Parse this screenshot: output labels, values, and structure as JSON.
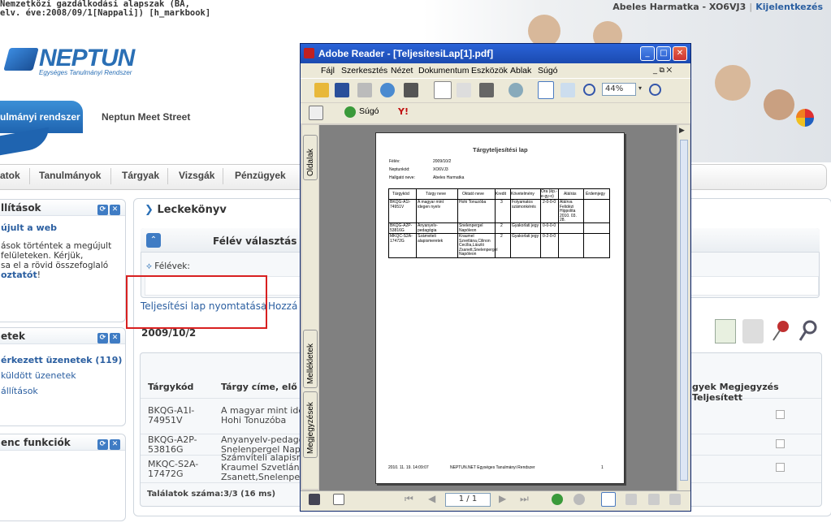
{
  "header": {
    "info_line1": "Nemzetközi gazdálkodási alapszak (BA,",
    "info_line2": "elv. éve:2008/09/1[Nappali]) [h_markbook]",
    "user": "Abeles Harmatka - XO6VJ3",
    "logout": "Kijelentkezés",
    "logo_name": "NEPTUN",
    "logo_sub": "Egységes Tanulmányi Rendszer",
    "tab_main": "ulmányi rendszer",
    "tab_meet": "Neptun Meet Street"
  },
  "menu": [
    "atok",
    "Tanulmányok",
    "Tárgyak",
    "Vizsgák",
    "Pénzügyek"
  ],
  "sidebar": {
    "box1": {
      "title": "llítások",
      "link": "újult a web",
      "text1": "ások történtek a megújult",
      "text2": "felületeken. Kérjük,",
      "text3": "sa el a rövid összefoglaló",
      "link2": "oztatót",
      "tail": "!"
    },
    "box2": {
      "title": "etek",
      "items": [
        "érkezett üzenetek (119)",
        "küldött üzenetek",
        "állítások"
      ]
    },
    "box3": {
      "title": "enc funkciók"
    }
  },
  "main": {
    "title": "Leckekönyv",
    "semester_panel_title": "Félév választás",
    "semesters_label": "Félévek:",
    "print_link": "Teljesítési lap nyomtatása",
    "add_link": "Hozzá",
    "semester": "2009/10/2",
    "columns": {
      "code": "Tárgykód",
      "name": "Tárgy címe, elő",
      "tail": "gyek Megjegyzés Teljesített"
    },
    "rows": [
      {
        "code1": "BKQG-A1I-",
        "code2": "74951V",
        "name1": "A magyar mint ideg",
        "name2": "Hohi Tonuzóba"
      },
      {
        "code1": "BKQG-A2P-",
        "code2": "53816G",
        "name1": "Anyanyelv-pedagóg",
        "name2": "Snelenpergel Napól"
      },
      {
        "code1": "MKQC-S2A-",
        "code2": "17472G",
        "name1": "Számviteli alapism",
        "name2": "Kraumel Szvetlána,",
        "name3": "Zsanett,Snelenperg"
      }
    ],
    "found": "Találatok száma:3/3 (16 ms)"
  },
  "adobe": {
    "title": "Adobe Reader - [TeljesitesiLap[1].pdf]",
    "menu": [
      "Fájl",
      "Szerkesztés",
      "Nézet",
      "Dokumentum",
      "Eszközök",
      "Ablak",
      "Súgó"
    ],
    "zoom": "44%",
    "help": "Súgó",
    "side_tabs": [
      "Oldalak",
      "Mellékletek",
      "Megjegyzések"
    ],
    "page_indicator": "1 / 1",
    "pdf": {
      "title": "Tárgyteljesítési lap",
      "felev_label": "Félév:",
      "felev": "2009/10/2",
      "neptun_label": "Neptunkód:",
      "neptun": "XO6VJ3",
      "name_label": "Hallgató neve:",
      "name": "Abeles Harmatka",
      "headers": [
        "Tárgykód",
        "Tárgy neve",
        "Oktató neve",
        "Kredit",
        "Követelmény",
        "Óra (ép.-e-gy-o)",
        "Aláírás",
        "Érdemjegy"
      ],
      "rows": [
        [
          "BKQG-A1I-74951V",
          "A magyar mint idegen nyelv",
          "Hohi Tonuzóba",
          "3",
          "Folyamatos számonkérés",
          "2-0-0-0",
          "Aláírva Felidézi Hippolita 2010. 03. 28.",
          ""
        ],
        [
          "BKQG-A2P-53816G",
          "Anyanyelv-pedagógia",
          "Snelenpergel Napóleon",
          "2",
          "Gyakorlati jegy",
          "0-0-0-0",
          "",
          ""
        ],
        [
          "MKQC-S2A-17472G",
          "Számviteli alapismeretek",
          "Kraumel Szvetlána,Cilinon Cecília,László Zsanett,Snelenpergel Napóleon",
          "2",
          "Gyakorlati jegy",
          "0-2-0-0",
          "",
          ""
        ]
      ],
      "footer_left": "2010. 11. 19. 14:09:07",
      "footer_mid": "NEPTUN.NET Egységes Tanulmányi Rendszer",
      "footer_right": "1"
    }
  }
}
